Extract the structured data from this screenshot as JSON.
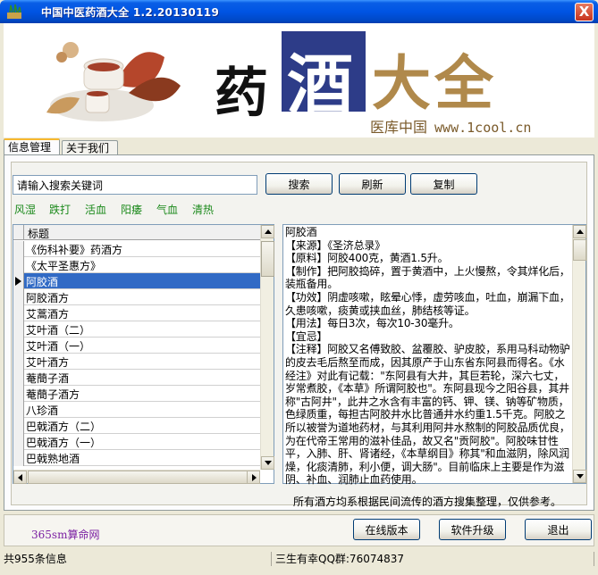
{
  "window": {
    "title": "中国中医药酒大全 1.2.20130119",
    "close_label": "X"
  },
  "banner": {
    "char1": "药",
    "char2": "酒",
    "char3": "大全",
    "site_name": "医库中国",
    "site_url": "www.1cool.cn"
  },
  "tabs": [
    {
      "label": "信息管理"
    },
    {
      "label": "关于我们"
    }
  ],
  "search": {
    "value": "请输入搜索关键词",
    "search_label": "搜索",
    "refresh_label": "刷新",
    "copy_label": "复制"
  },
  "categories": [
    "风湿",
    "跌打",
    "活血",
    "阳痿",
    "气血",
    "清热"
  ],
  "list": {
    "header": "标题",
    "items": [
      "《伤科补要》药酒方",
      "《太平圣惠方》",
      "阿胶酒",
      "阿胶酒方",
      "艾蒿酒方",
      "艾叶酒（二）",
      "艾叶酒（一）",
      "艾叶酒方",
      "菴蕳子酒",
      "菴蕳子酒方",
      "八珍酒",
      "巴戟酒方（二）",
      "巴戟酒方（一）",
      "巴戟熟地酒"
    ],
    "selected": "阿胶酒"
  },
  "detail": {
    "text": "阿胶酒\n【来源】《圣济总录》\n【原料】阿胶400克，黄酒1.5升。\n【制作】把阿胶捣碎，置于黄酒中，上火慢熬，令其烊化后，装瓶备用。\n【功效】阴虚咳嗽，眩晕心悸，虚劳咳血，吐血，崩漏下血，久患咳嗽，痰黄或挟血丝，肺结核等证。\n【用法】每日3次，每次10-30毫升。\n【宜忌】\n【注释】阿胶又名傅致胶、盆覆胶、驴皮胶，系用马科动物驴的皮去毛后熬至而成，因其原产于山东省东阿县而得名。《水经注》对此有记载：\"东阿县有大井，其巨若轮，深六七丈，岁常煮胶，《本草》所谓阿胶也\"。东阿县现今之阳谷县，其井称\"古阿井\"，此井之水含有丰富的钙、钾、镁、钠等矿物质，色绿质重，每担古阿胶井水比普通井水约重1.5千克。阿胶之所以被誉为道地药材，与其利用阿井水熬制的阿胶品质优良，为在代帝王常用的滋补佳品，故又名\"贡阿胶\"。阿胶味甘性平，入肺、肝、肾诸经，《本草纲目》称其\"和血滋阴，除风润燥，化痰清肺，利小便，调大肠\"。目前临床上主要是作为滋阴、补血、润肺止血药使用。"
  },
  "note": "所有酒方均系根据民间流传的酒方搜集整理，仅供参考。",
  "footer": {
    "brand": "365sm算命网",
    "online_label": "在线版本",
    "upgrade_label": "软件升级",
    "exit_label": "退出"
  },
  "status": {
    "count": "共955条信息",
    "qq": "三生有幸QQ群:76074837"
  }
}
